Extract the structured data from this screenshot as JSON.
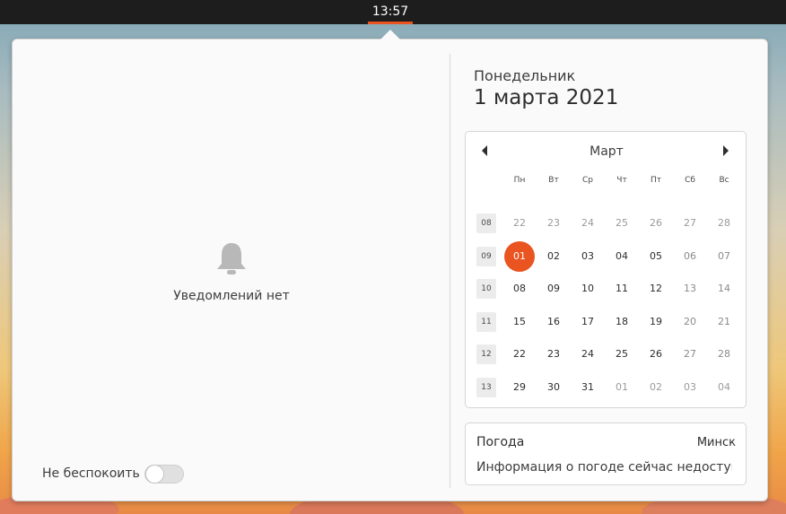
{
  "topbar": {
    "clock": "13:57"
  },
  "notifications": {
    "empty_text": "Уведомлений нет",
    "bell_icon": "bell-icon",
    "dnd_label": "Не беспокоить",
    "dnd_enabled": false
  },
  "date": {
    "weekday": "Понедельник",
    "full": "1 марта 2021"
  },
  "calendar": {
    "month": "Март",
    "weekdays": [
      "Пн",
      "Вт",
      "Ср",
      "Чт",
      "Пт",
      "Сб",
      "Вс"
    ],
    "weeks": [
      {
        "num": "08",
        "days": [
          {
            "d": "22",
            "cls": "other"
          },
          {
            "d": "23",
            "cls": "other"
          },
          {
            "d": "24",
            "cls": "other"
          },
          {
            "d": "25",
            "cls": "other"
          },
          {
            "d": "26",
            "cls": "other"
          },
          {
            "d": "27",
            "cls": "other"
          },
          {
            "d": "28",
            "cls": "other"
          }
        ]
      },
      {
        "num": "09",
        "days": [
          {
            "d": "01",
            "cls": "today"
          },
          {
            "d": "02",
            "cls": ""
          },
          {
            "d": "03",
            "cls": ""
          },
          {
            "d": "04",
            "cls": ""
          },
          {
            "d": "05",
            "cls": ""
          },
          {
            "d": "06",
            "cls": "weekend"
          },
          {
            "d": "07",
            "cls": "weekend"
          }
        ]
      },
      {
        "num": "10",
        "days": [
          {
            "d": "08",
            "cls": ""
          },
          {
            "d": "09",
            "cls": ""
          },
          {
            "d": "10",
            "cls": ""
          },
          {
            "d": "11",
            "cls": ""
          },
          {
            "d": "12",
            "cls": ""
          },
          {
            "d": "13",
            "cls": "weekend"
          },
          {
            "d": "14",
            "cls": "weekend"
          }
        ]
      },
      {
        "num": "11",
        "days": [
          {
            "d": "15",
            "cls": ""
          },
          {
            "d": "16",
            "cls": ""
          },
          {
            "d": "17",
            "cls": ""
          },
          {
            "d": "18",
            "cls": ""
          },
          {
            "d": "19",
            "cls": ""
          },
          {
            "d": "20",
            "cls": "weekend"
          },
          {
            "d": "21",
            "cls": "weekend"
          }
        ]
      },
      {
        "num": "12",
        "days": [
          {
            "d": "22",
            "cls": ""
          },
          {
            "d": "23",
            "cls": ""
          },
          {
            "d": "24",
            "cls": ""
          },
          {
            "d": "25",
            "cls": ""
          },
          {
            "d": "26",
            "cls": ""
          },
          {
            "d": "27",
            "cls": "weekend"
          },
          {
            "d": "28",
            "cls": "weekend"
          }
        ]
      },
      {
        "num": "13",
        "days": [
          {
            "d": "29",
            "cls": ""
          },
          {
            "d": "30",
            "cls": ""
          },
          {
            "d": "31",
            "cls": ""
          },
          {
            "d": "01",
            "cls": "other"
          },
          {
            "d": "02",
            "cls": "other"
          },
          {
            "d": "03",
            "cls": "other"
          },
          {
            "d": "04",
            "cls": "other"
          }
        ]
      }
    ]
  },
  "weather": {
    "title": "Погода",
    "city": "Минск",
    "info": "Информация о погоде сейчас недоступ..."
  },
  "colors": {
    "accent": "#e95420",
    "topbar": "#1d1d1d",
    "panel": "#fafafa"
  }
}
